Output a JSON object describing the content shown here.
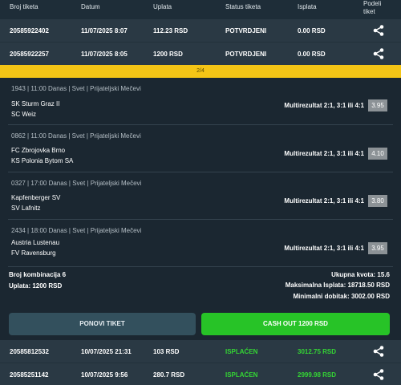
{
  "header": {
    "ticket_id": "Broj tiketa",
    "date": "Datum",
    "payment": "Uplata",
    "status": "Status tiketa",
    "payout": "Isplata",
    "share_line1": "Podeli",
    "share_line2": "tiket"
  },
  "top_tickets": [
    {
      "id": "20585922402",
      "date": "11/07/2025 8:07",
      "payment": "112.23 RSD",
      "status": "POTVRDJENI",
      "payout": "0.00 RSD"
    },
    {
      "id": "20585922257",
      "date": "11/07/2025 8:05",
      "payment": "1200 RSD",
      "status": "POTVRDJENI",
      "payout": "0.00 RSD"
    }
  ],
  "pager": "2/4",
  "matches": [
    {
      "meta": "1943 | 11:00 Danas | Svet | Prijateljski Mečevi",
      "home": "SK Sturm Graz II",
      "away": "SC Weiz",
      "pick": "Multirezultat 2:1, 3:1 ili 4:1",
      "odds": "3.95"
    },
    {
      "meta": "0862 | 11:00 Danas | Svet | Prijateljski Mečevi",
      "home": "FC Zbrojovka Brno",
      "away": "KS Polonia Bytom SA",
      "pick": "Multirezultat 2:1, 3:1 ili 4:1",
      "odds": "4.10"
    },
    {
      "meta": "0327 | 17:00 Danas | Svet | Prijateljski Mečevi",
      "home": "Kapfenberger SV",
      "away": "SV Lafnitz",
      "pick": "Multirezultat 2:1, 3:1 ili 4:1",
      "odds": "3.80"
    },
    {
      "meta": "2434 | 18:00 Danas | Svet | Prijateljski Mečevi",
      "home": "Austria Lustenau",
      "away": "FV Ravensburg",
      "pick": "Multirezultat 2:1, 3:1 ili 4:1",
      "odds": "3.95"
    }
  ],
  "summary": {
    "combinations": "Broj kombinacija 6",
    "payment": "Uplata: 1200 RSD",
    "total_odds": "Ukupna kvota: 15.6",
    "max_payout": "Maksimalna Isplata: 18718.50 RSD",
    "min_win": "Minimalni dobitak: 3002.00 RSD"
  },
  "buttons": {
    "repeat": "PONOVI TIKET",
    "cashout": "CASH OUT 1200 RSD"
  },
  "bottom_tickets": [
    {
      "id": "20585812532",
      "date": "10/07/2025 21:31",
      "payment": "103 RSD",
      "status": "ISPLAĆEN",
      "payout": "3012.75 RSD"
    },
    {
      "id": "20585251142",
      "date": "10/07/2025 9:56",
      "payment": "280.7 RSD",
      "status": "ISPLAĆEN",
      "payout": "2999.98 RSD"
    }
  ],
  "colors": {
    "accent_yellow": "#f4c516",
    "cashout_green": "#27c327",
    "status_paid": "#34d634"
  }
}
